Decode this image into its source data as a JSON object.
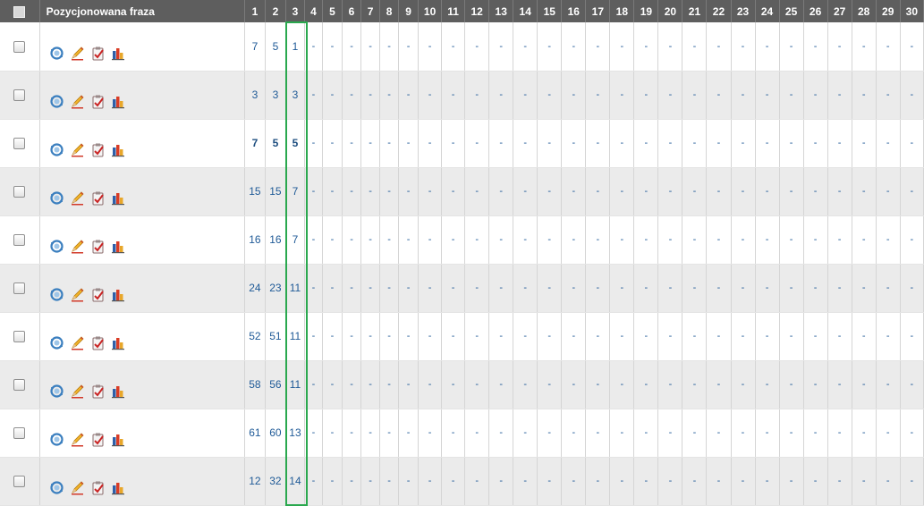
{
  "table": {
    "header": {
      "phrase": "Pozycjonowana fraza",
      "days": [
        "1",
        "2",
        "3",
        "4",
        "5",
        "6",
        "7",
        "8",
        "9",
        "10",
        "11",
        "12",
        "13",
        "14",
        "15",
        "16",
        "17",
        "18",
        "19",
        "20",
        "21",
        "22",
        "23",
        "24",
        "25",
        "26",
        "27",
        "28",
        "29",
        "30"
      ]
    },
    "empty_value": "-",
    "rows": [
      {
        "positions": [
          "7",
          "5",
          "1"
        ],
        "bold": false
      },
      {
        "positions": [
          "3",
          "3",
          "3"
        ],
        "bold": false
      },
      {
        "positions": [
          "7",
          "5",
          "5"
        ],
        "bold": true
      },
      {
        "positions": [
          "15",
          "15",
          "7"
        ],
        "bold": false
      },
      {
        "positions": [
          "16",
          "16",
          "7"
        ],
        "bold": false
      },
      {
        "positions": [
          "24",
          "23",
          "11"
        ],
        "bold": false
      },
      {
        "positions": [
          "52",
          "51",
          "11"
        ],
        "bold": false
      },
      {
        "positions": [
          "58",
          "56",
          "11"
        ],
        "bold": false
      },
      {
        "positions": [
          "61",
          "60",
          "13"
        ],
        "bold": false
      },
      {
        "positions": [
          "12",
          "32",
          "14"
        ],
        "bold": false
      }
    ],
    "row_icons": [
      "refresh-icon",
      "edit-pencil-icon",
      "checklist-icon",
      "bar-chart-icon"
    ],
    "highlight_color": "#2aa84e"
  }
}
